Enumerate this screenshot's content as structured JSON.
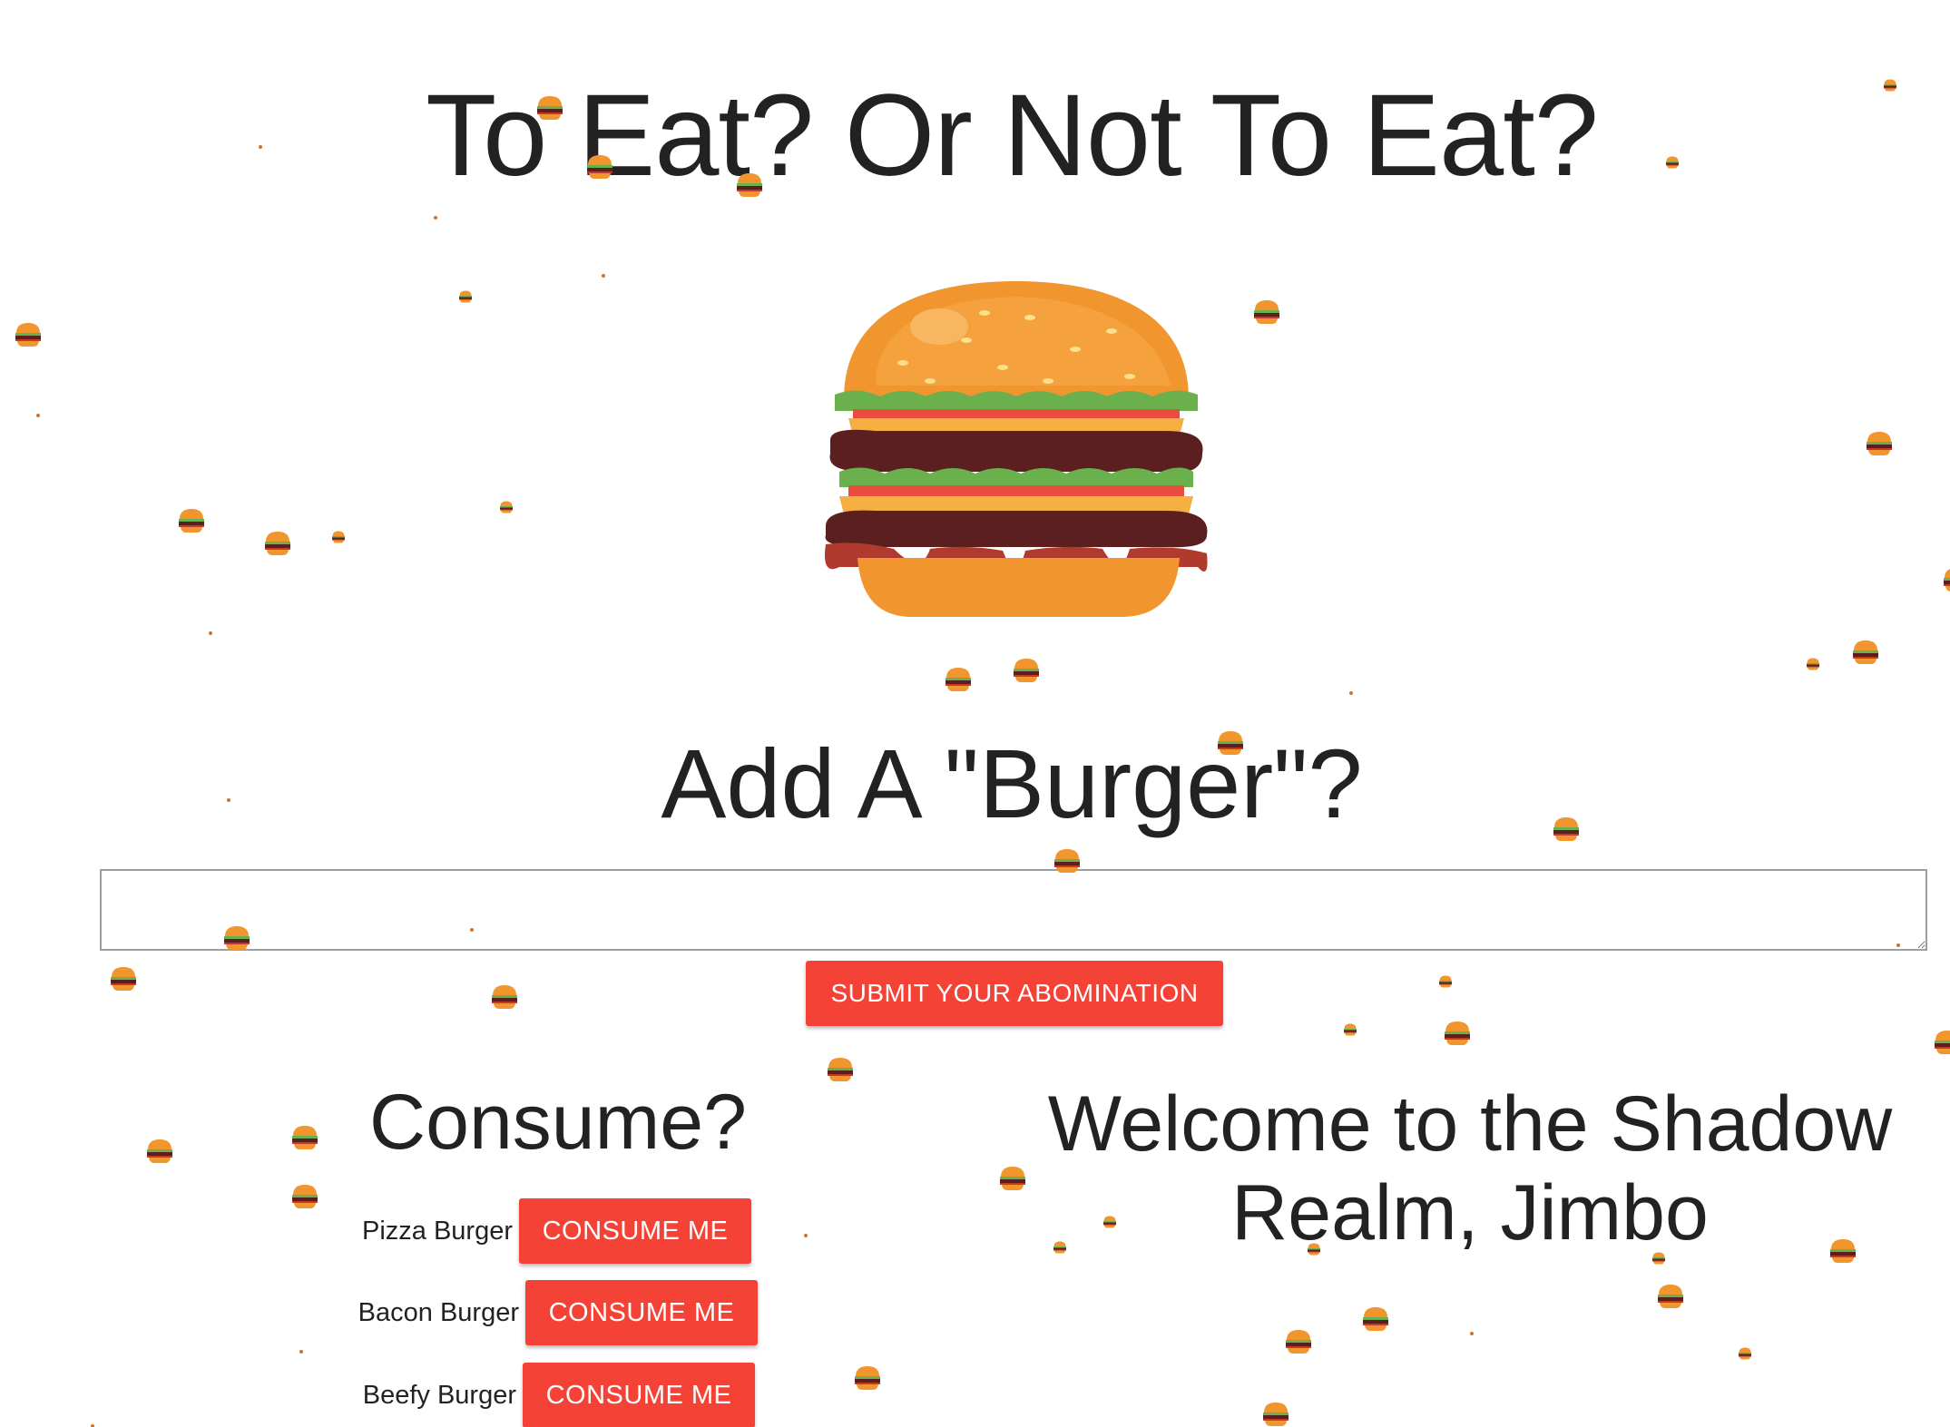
{
  "page": {
    "title": "To Eat? Or Not To Eat?",
    "add_title": "Add A \"Burger\"?",
    "textarea_value": "",
    "submit_label": "SUBMIT YOUR ABOMINATION",
    "consume_title": "Consume?",
    "devoured_title": "Welcome to the Shadow Realm, Jimbo"
  },
  "burgers": [
    {
      "name": "Pizza Burger",
      "button": "CONSUME ME"
    },
    {
      "name": "Bacon Burger",
      "button": "CONSUME ME"
    },
    {
      "name": "Beefy Burger",
      "button": "CONSUME ME"
    }
  ],
  "colors": {
    "accent": "#f44336",
    "text": "#222222",
    "background": "#ffffff"
  },
  "icons": {
    "hero": "burger-icon",
    "falling": "mini-burger-icon"
  }
}
